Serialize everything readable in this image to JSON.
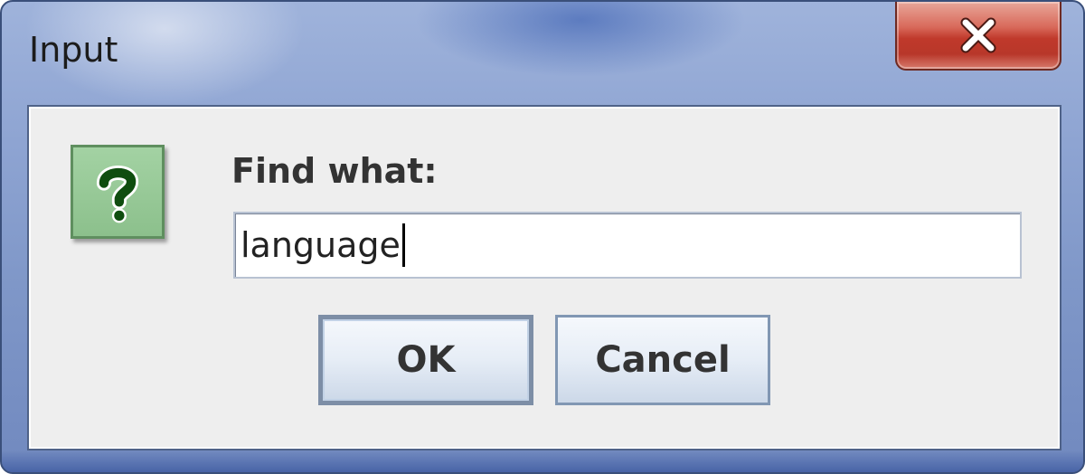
{
  "window": {
    "title": "Input"
  },
  "titlebar": {
    "close_icon": "close-icon"
  },
  "dialog": {
    "icon": "question-icon",
    "prompt": "Find what:",
    "input_value": "language",
    "ok_label": "OK",
    "cancel_label": "Cancel"
  },
  "colors": {
    "icon_green": "#8cc08c",
    "close_red": "#c0392b",
    "client_bg": "#eeeeee"
  }
}
